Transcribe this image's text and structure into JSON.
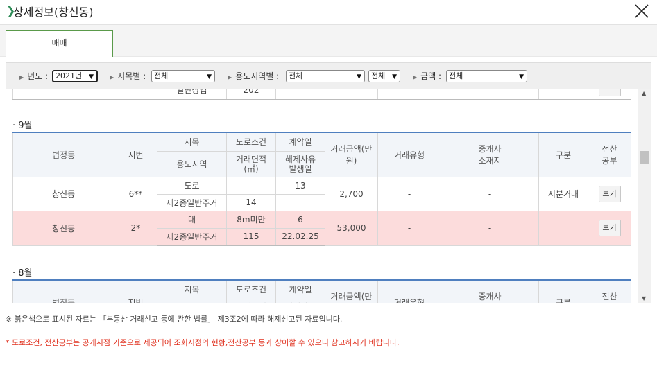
{
  "title": {
    "arrow": "❯",
    "text": "상세정보(창신동)"
  },
  "tabs": [
    {
      "label": "매매"
    }
  ],
  "filters": {
    "year": {
      "label": "년도 :",
      "value": "2021년"
    },
    "jimok": {
      "label": "지목별 :",
      "value": "전체"
    },
    "zone": {
      "label": "용도지역별 :",
      "value": "전체",
      "value2": "전체"
    },
    "amount": {
      "label": "금액 :",
      "value": "전체"
    }
  },
  "prev_row": {
    "cells": [
      "일반상업",
      "202"
    ]
  },
  "header": {
    "beopjeongdong": "법정동",
    "jibeon": "지번",
    "jimok": "지목",
    "yongdo": "용도지역",
    "road": "도로조건",
    "area": "거래면적\n(㎡)",
    "contract": "계약일",
    "cancel": "해제사유\n발생일",
    "price": "거래금액(만\n원)",
    "type": "거래유형",
    "broker": "중개사\n소재지",
    "gubun": "구분",
    "docs": "전산\n공부"
  },
  "sections": [
    {
      "month": "9월",
      "rows": [
        {
          "dong": "창신동",
          "jibeon": "6**",
          "jimok": "도로",
          "yongdo": "제2종일반주거",
          "road": "-",
          "area": "14",
          "contract": "13",
          "cancel": "",
          "price": "2,700",
          "type": "-",
          "broker": "-",
          "gubun": "지분거래",
          "btn": "보기",
          "cancelled": false
        },
        {
          "dong": "창신동",
          "jibeon": "2*",
          "jimok": "대",
          "yongdo": "제2종일반주거",
          "road": "8m미만",
          "area": "115",
          "contract": "6",
          "cancel": "22.02.25",
          "price": "53,000",
          "type": "-",
          "broker": "-",
          "gubun": "",
          "btn": "보기",
          "cancelled": true
        }
      ]
    },
    {
      "month": "8월"
    }
  ],
  "notes": {
    "note1": "※ 붉은색으로 표시된 자료는 「부동산 거래신고 등에 관한 법률」 제3조2에 따라 해제신고된 자료입니다.",
    "note2": "* 도로조건, 전산공부는 공개시점 기준으로 제공되어 조회시점의 현황,전산공부 등과 상이할 수 있으니 참고하시기 바랍니다."
  },
  "colors": {
    "cancelled_row": "#fcdcdc",
    "header_border": "#4f7fbf",
    "note_red": "#e0301e",
    "tab_border": "#5a9a4a"
  }
}
